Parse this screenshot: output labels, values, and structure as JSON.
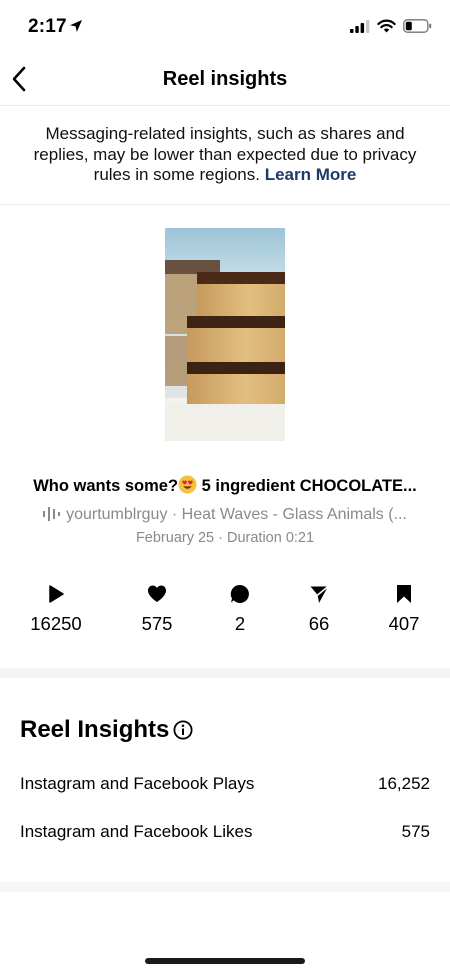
{
  "status_bar": {
    "time": "2:17"
  },
  "nav": {
    "title": "Reel insights"
  },
  "notice": {
    "text": "Messaging-related insights, such as shares and replies, may be lower than expected due to privacy rules in some regions.",
    "link": "Learn More"
  },
  "reel": {
    "caption_start": "Who wants some?",
    "caption_end": " 5 ingredient CHOCOLATE...",
    "audio": "yourtumblrguy · Heat Waves - Glass Animals (...",
    "meta": "February 25 · Duration 0:21"
  },
  "stats": {
    "plays": "16250",
    "likes": "575",
    "comments": "2",
    "shares": "66",
    "saves": "407"
  },
  "insights": {
    "title": "Reel Insights",
    "rows": [
      {
        "label": "Instagram and Facebook Plays",
        "value": "16,252"
      },
      {
        "label": "Instagram and Facebook Likes",
        "value": "575"
      }
    ]
  },
  "colors": {
    "link": "#1e3a6c",
    "secondary_text": "#8a8a8a"
  },
  "icons": [
    "location-arrow-icon",
    "signal-icon",
    "wifi-icon",
    "battery-icon",
    "back-chevron-icon",
    "heart-eyes-emoji-icon",
    "audio-wave-icon",
    "play-icon",
    "heart-icon",
    "comment-icon",
    "send-icon",
    "bookmark-icon",
    "info-icon"
  ]
}
